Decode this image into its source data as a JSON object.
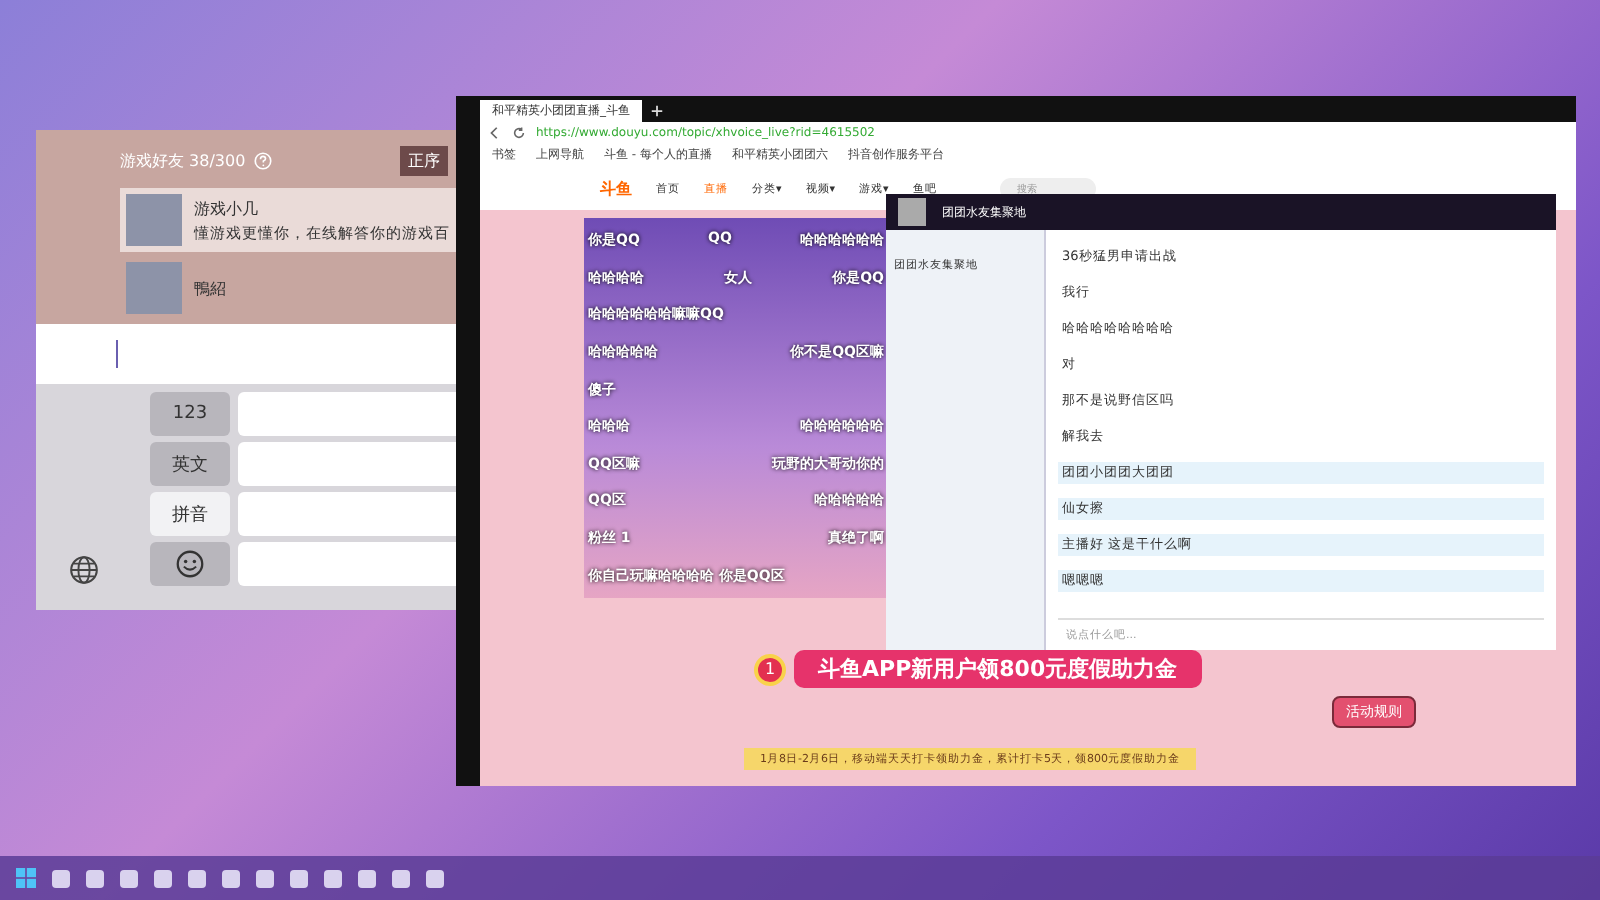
{
  "friends_panel": {
    "title": "游戏好友 38/300",
    "sort": "正序",
    "friends": [
      {
        "name": "游戏小几",
        "status": "懂游戏更懂你，在线解答你的游戏百"
      },
      {
        "name": "鴨紹"
      }
    ]
  },
  "keyboard": {
    "keys": [
      {
        "kind": "text",
        "label": "123",
        "selected": false
      },
      {
        "kind": "text",
        "label": "英文",
        "selected": false
      },
      {
        "kind": "text",
        "label": "拼音",
        "selected": true
      },
      {
        "kind": "emoji",
        "selected": false
      }
    ]
  },
  "browser": {
    "tab_title": "和平精英小团团直播_斗鱼",
    "url": "https://www.douyu.com/topic/xhvoice_live?rid=4615502",
    "bookmarks": [
      "书签",
      "上网导航",
      "斗鱼 - 每个人的直播",
      "和平精英小团团六",
      "抖音创作服务平台"
    ],
    "site": {
      "logo": "斗鱼",
      "nav": [
        {
          "label": "首页",
          "selected": false
        },
        {
          "label": "直播",
          "selected": true
        },
        {
          "label": "分类▾",
          "selected": false
        },
        {
          "label": "视频▾",
          "selected": false
        },
        {
          "label": "游戏▾",
          "selected": false
        },
        {
          "label": "鱼吧",
          "selected": false
        }
      ],
      "search_placeholder": "搜索"
    },
    "danmaku": [
      [
        "你是QQ",
        "QQ",
        "哈哈哈哈哈哈"
      ],
      [
        "哈哈哈哈",
        "女人",
        "你是QQ"
      ],
      [
        "哈哈哈哈哈哈嘛嘛QQ"
      ],
      [
        "哈哈哈哈哈",
        "你不是QQ区嘛"
      ],
      [
        "傻子"
      ],
      [
        "哈哈哈",
        "哈哈哈哈哈哈"
      ],
      [
        "QQ区嘛",
        "玩野的大哥动你的"
      ],
      [
        "QQ区",
        "哈哈哈哈哈"
      ],
      [
        "粉丝 1",
        "真绝了啊"
      ],
      [
        "你自己玩嘛哈哈哈哈 你是QQ区"
      ]
    ],
    "chat": {
      "title": "团团水友集聚地",
      "channel": "团团水友集聚地",
      "messages": [
        {
          "text": "36秒猛男申请出战",
          "highlight": false
        },
        {
          "text": "我行",
          "highlight": false
        },
        {
          "text": "哈哈哈哈哈哈哈哈",
          "highlight": false
        },
        {
          "text": "对",
          "highlight": false
        },
        {
          "text": "那不是说野信区吗",
          "highlight": false
        },
        {
          "text": "解我去",
          "highlight": false
        },
        {
          "text": "团团小团团大团团",
          "highlight": true
        },
        {
          "text": "仙女擦",
          "highlight": true
        },
        {
          "text": "主播好 这是干什么啊",
          "highlight": true
        },
        {
          "text": "嗯嗯嗯",
          "highlight": true
        }
      ],
      "input_placeholder": "说点什么吧..."
    },
    "banner": {
      "number": "1",
      "title": "斗鱼APP新用户领800元度假助力金",
      "rules": "活动规则",
      "note": "1月8日-2月6日，移动端天天打卡领助力金，累计打卡5天，领800元度假助力金"
    }
  }
}
